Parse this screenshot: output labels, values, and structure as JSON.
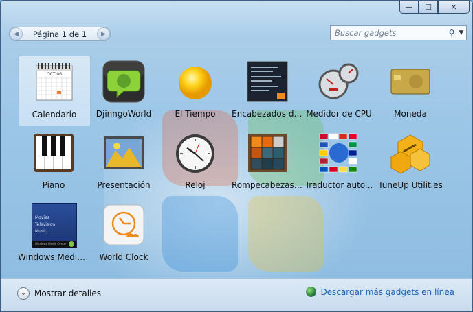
{
  "window": {
    "controls": {
      "minimize": "—",
      "maximize": "☐",
      "close": "✕"
    }
  },
  "pager": {
    "label": "Página 1 de 1",
    "prev": "◀",
    "next": "▶"
  },
  "search": {
    "placeholder": "Buscar gadgets",
    "icon": "search-icon",
    "dropdown": "▼"
  },
  "gadgets": [
    {
      "label": "Calendario",
      "icon": "calendar-icon",
      "selected": true
    },
    {
      "label": "DjinngoWorld",
      "icon": "chat-globe-icon"
    },
    {
      "label": "El Tiempo",
      "icon": "sun-icon"
    },
    {
      "label": "Encabezados de...",
      "icon": "rss-headlines-icon"
    },
    {
      "label": "Medidor de CPU",
      "icon": "cpu-gauge-icon"
    },
    {
      "label": "Moneda",
      "icon": "currency-card-icon"
    },
    {
      "label": "Piano",
      "icon": "piano-icon"
    },
    {
      "label": "Presentación",
      "icon": "slideshow-icon"
    },
    {
      "label": "Reloj",
      "icon": "clock-icon"
    },
    {
      "label": "Rompecabezas ...",
      "icon": "puzzle-icon"
    },
    {
      "label": "Traductor auto...",
      "icon": "flags-translator-icon"
    },
    {
      "label": "TuneUp Utilities",
      "icon": "tuneup-icon"
    },
    {
      "label": "Windows Media...",
      "icon": "media-center-icon"
    },
    {
      "label": "World Clock",
      "icon": "world-clock-icon"
    }
  ],
  "media_center_menu": [
    "Movies",
    "Television",
    "Music"
  ],
  "media_center_caption": "Windows Media Center",
  "calendar_month": "OCT 06",
  "footer": {
    "details_label": "Mostrar detalles",
    "download_label": "Descargar más gadgets en línea"
  }
}
